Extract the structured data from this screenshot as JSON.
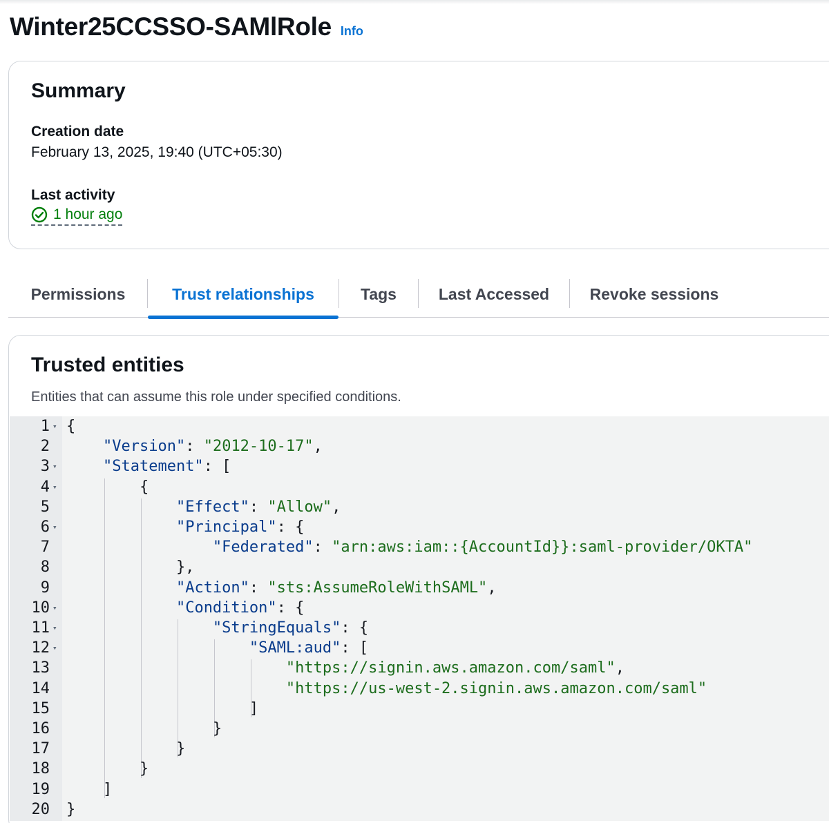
{
  "header": {
    "title": "Winter25CCSSO-SAMlRole",
    "info_link": "Info"
  },
  "summary": {
    "title": "Summary",
    "creation_date_label": "Creation date",
    "creation_date_value": "February 13, 2025, 19:40 (UTC+05:30)",
    "last_activity_label": "Last activity",
    "last_activity_value": "1 hour ago",
    "last_activity_icon": "check-circle-icon",
    "status_color": "#037f0c"
  },
  "tabs": [
    {
      "label": "Permissions",
      "active": false
    },
    {
      "label": "Trust relationships",
      "active": true
    },
    {
      "label": "Tags",
      "active": false
    },
    {
      "label": "Last Accessed",
      "active": false
    },
    {
      "label": "Revoke sessions",
      "active": false
    }
  ],
  "trusted_entities": {
    "title": "Trusted entities",
    "description": "Entities that can assume this role under specified conditions.",
    "policy_lines": [
      {
        "n": "1",
        "fold": true,
        "text": "{"
      },
      {
        "n": "2",
        "fold": false,
        "text": "    \"Version\": \"2012-10-17\","
      },
      {
        "n": "3",
        "fold": true,
        "text": "    \"Statement\": ["
      },
      {
        "n": "4",
        "fold": true,
        "text": "        {"
      },
      {
        "n": "5",
        "fold": false,
        "text": "            \"Effect\": \"Allow\","
      },
      {
        "n": "6",
        "fold": true,
        "text": "            \"Principal\": {"
      },
      {
        "n": "7",
        "fold": false,
        "text": "                \"Federated\": \"arn:aws:iam::{AccountId}}:saml-provider/OKTA\""
      },
      {
        "n": "8",
        "fold": false,
        "text": "            },"
      },
      {
        "n": "9",
        "fold": false,
        "text": "            \"Action\": \"sts:AssumeRoleWithSAML\","
      },
      {
        "n": "10",
        "fold": true,
        "text": "            \"Condition\": {"
      },
      {
        "n": "11",
        "fold": true,
        "text": "                \"StringEquals\": {"
      },
      {
        "n": "12",
        "fold": true,
        "text": "                    \"SAML:aud\": ["
      },
      {
        "n": "13",
        "fold": false,
        "text": "                        \"https://signin.aws.amazon.com/saml\","
      },
      {
        "n": "14",
        "fold": false,
        "text": "                        \"https://us-west-2.signin.aws.amazon.com/saml\""
      },
      {
        "n": "15",
        "fold": false,
        "text": "                    ]"
      },
      {
        "n": "16",
        "fold": false,
        "text": "                }"
      },
      {
        "n": "17",
        "fold": false,
        "text": "            }"
      },
      {
        "n": "18",
        "fold": false,
        "text": "        }"
      },
      {
        "n": "19",
        "fold": false,
        "text": "    ]"
      },
      {
        "n": "20",
        "fold": false,
        "text": "}"
      }
    ]
  }
}
